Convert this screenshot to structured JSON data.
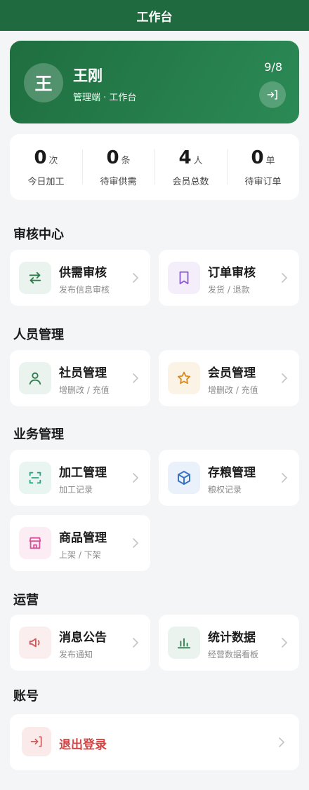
{
  "header": {
    "title": "工作台"
  },
  "profile": {
    "avatar_text": "王",
    "name": "王刚",
    "role": "管理端 · 工作台",
    "date": "9/8"
  },
  "stats": [
    {
      "value": "0",
      "unit": "次",
      "label": "今日加工"
    },
    {
      "value": "0",
      "unit": "条",
      "label": "待审供需"
    },
    {
      "value": "4",
      "unit": "人",
      "label": "会员总数"
    },
    {
      "value": "0",
      "unit": "单",
      "label": "待审订单"
    }
  ],
  "sections": {
    "review": {
      "title": "审核中心",
      "items": [
        {
          "title": "供需审核",
          "subtitle": "发布信息审核",
          "icon": "swap-icon",
          "color": "#2e7d4f"
        },
        {
          "title": "订单审核",
          "subtitle": "发货 / 退款",
          "icon": "receipt-icon",
          "color": "#8e5bd0"
        }
      ]
    },
    "staff": {
      "title": "人员管理",
      "items": [
        {
          "title": "社员管理",
          "subtitle": "增删改 / 充值",
          "icon": "user-icon",
          "color": "#2e7d4f"
        },
        {
          "title": "会员管理",
          "subtitle": "增删改 / 充值",
          "icon": "star-icon",
          "color": "#d98a1e"
        }
      ]
    },
    "business": {
      "title": "业务管理",
      "items": [
        {
          "title": "加工管理",
          "subtitle": "加工记录",
          "icon": "scan-icon",
          "color": "#2aa383"
        },
        {
          "title": "存粮管理",
          "subtitle": "粮权记录",
          "icon": "box-icon",
          "color": "#3b73c4"
        },
        {
          "title": "商品管理",
          "subtitle": "上架 / 下架",
          "icon": "store-icon",
          "color": "#d9509a"
        }
      ]
    },
    "operations": {
      "title": "运营",
      "items": [
        {
          "title": "消息公告",
          "subtitle": "发布通知",
          "icon": "megaphone-icon",
          "color": "#c75b5b"
        },
        {
          "title": "统计数据",
          "subtitle": "经营数据看板",
          "icon": "bar-chart-icon",
          "color": "#2e7d4f"
        }
      ]
    },
    "account": {
      "title": "账号",
      "logout_label": "退出登录"
    }
  }
}
